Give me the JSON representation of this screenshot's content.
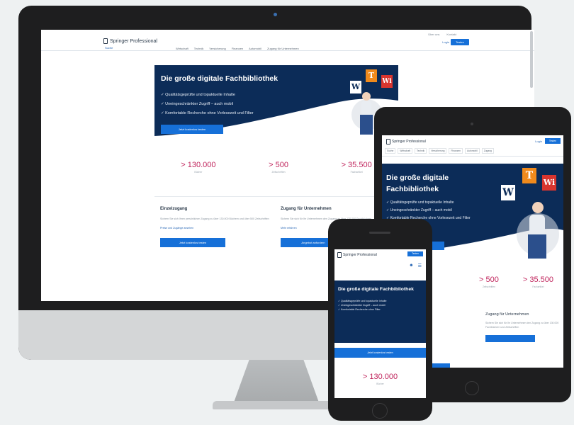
{
  "desktop": {
    "brand": "Springer Professional",
    "toplinks": [
      "Über uns",
      "Kontakt"
    ],
    "login": "Login",
    "register": "Testen",
    "search": "Suche",
    "nav": [
      "Wirtschaft",
      "Technik",
      "Versicherung",
      "Finanzen",
      "Automobil",
      "Zugang für Unternehmen"
    ],
    "hero": {
      "title": "Die große digitale Fachbibliothek",
      "checks": [
        "✓ Qualitätsgeprüfte und topaktuelle Inhalte",
        "✓ Uneingeschränkter Zugriff – auch mobil",
        "✓ Komfortable Recherche ohne Vorlesezeit und Filter"
      ],
      "button": "Jetzt kostenlos testen"
    },
    "stats": [
      {
        "num": "> 130.000",
        "label": "Bücher"
      },
      {
        "num": "> 500",
        "label": "Zeitschriften"
      },
      {
        "num": "> 35.500",
        "label": "Fachartikel"
      }
    ],
    "col1": {
      "title": "Einzelzugang",
      "text": "Sichern Sie sich Ihren persönlichen Zugang zu über 130.000 Büchern und über 500 Zeitschriften",
      "link": "Preise und Zugänge ansehen",
      "button": "Jetzt kostenlos testen"
    },
    "col2": {
      "title": "Zugang für Unternehmen",
      "text": "Sichern Sie sich für Ihr Unternehmen den Zugang zu über 130.000 Fachbüchern",
      "link": "Mehr erfahren",
      "button": "Angebot anfordern"
    }
  },
  "tablet": {
    "brand": "Springer Professional",
    "login": "Login",
    "register": "Testen",
    "nav": [
      "Suche",
      "Wirtschaft",
      "Technik",
      "Versicherung",
      "Finanzen",
      "Automobil",
      "Zugang"
    ],
    "hero": {
      "title": "Die große digitale Fachbibliothek",
      "checks": [
        "✓ Qualitätsgeprüfte und topaktuelle Inhalte",
        "✓ Uneingeschränkter Zugriff – auch mobil",
        "✓ Komfortable Recherche ohne Vorlesezeit und Filter"
      ]
    },
    "stats": [
      {
        "num": "> 500",
        "label": "Zeitschriften"
      },
      {
        "num": "> 35.500",
        "label": "Fachartikel"
      }
    ],
    "col": {
      "title": "Zugang für Unternehmen",
      "text": "Sichern Sie sich für Ihr Unternehmen den Zugang zu über 130.000 Fachbüchern und Zeitschriften"
    }
  },
  "phone": {
    "brand": "Springer Professional",
    "register": "Testen",
    "hero": {
      "title": "Die große digitale Fachbibliothek",
      "checks": [
        "✓ Qualitätsgeprüfte und topaktuelle Inhalte",
        "✓ Uneingeschränkter Zugriff – auch mobil",
        "✓ Komfortable Recherche ohne Filter"
      ]
    },
    "button": "Jetzt kostenlos testen",
    "stat": {
      "num": "> 130.000",
      "label": "Bücher"
    }
  },
  "books": {
    "w": "W",
    "t": "T",
    "wi": "Wi"
  },
  "colors": {
    "navy": "#0c2c58",
    "blue": "#1670d8",
    "accent": "#c0245c"
  }
}
